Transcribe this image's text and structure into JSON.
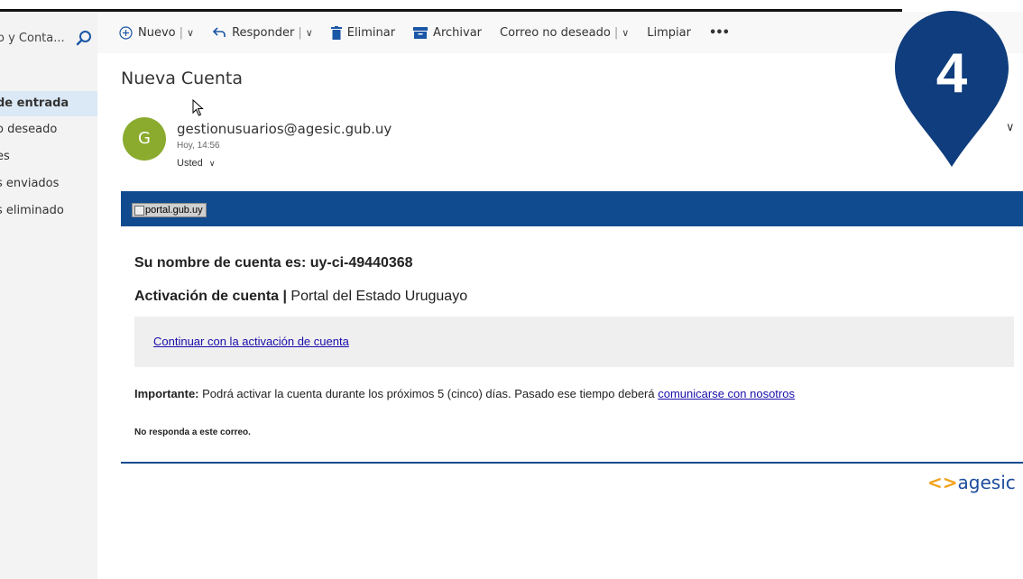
{
  "sidebar": {
    "search_text": "o y Conta...",
    "folders": [
      {
        "label": "de entrada",
        "active": true
      },
      {
        "label": "o deseado",
        "active": false
      },
      {
        "label": "es",
        "active": false
      },
      {
        "label": "s enviados",
        "active": false
      },
      {
        "label": "s eliminado",
        "active": false
      }
    ]
  },
  "toolbar": {
    "new_label": "Nuevo",
    "reply_label": "Responder",
    "delete_label": "Eliminar",
    "archive_label": "Archivar",
    "junk_label": "Correo no deseado",
    "sweep_label": "Limpiar",
    "more_label": "•••"
  },
  "email": {
    "subject": "Nueva Cuenta",
    "avatar_initial": "G",
    "sender": "gestionusuarios@agesic.gub.uy",
    "time": "Hoy, 14:56",
    "recipient": "Usted",
    "portal_alt": "portal.gub.uy",
    "account_name_line": "Su nombre de cuenta es: uy-ci-49440368",
    "activation_title": "Activación de cuenta |",
    "activation_portal": " Portal del Estado Uruguayo",
    "continue_link": "Continuar con la activación de cuenta",
    "important_label": "Importante:",
    "important_text": " Podrá activar la cuenta durante los próximos 5 (cinco) días. Pasado ese tiempo deberá ",
    "contact_link": "comunicarse con nosotros",
    "noreply": "No responda a este correo.",
    "logo_text": "agesic"
  },
  "marker": {
    "number": "4",
    "color": "#0f3d7d"
  },
  "colors": {
    "banner": "#114b8f",
    "avatar": "#8aab2e",
    "link": "#1a0dab"
  }
}
